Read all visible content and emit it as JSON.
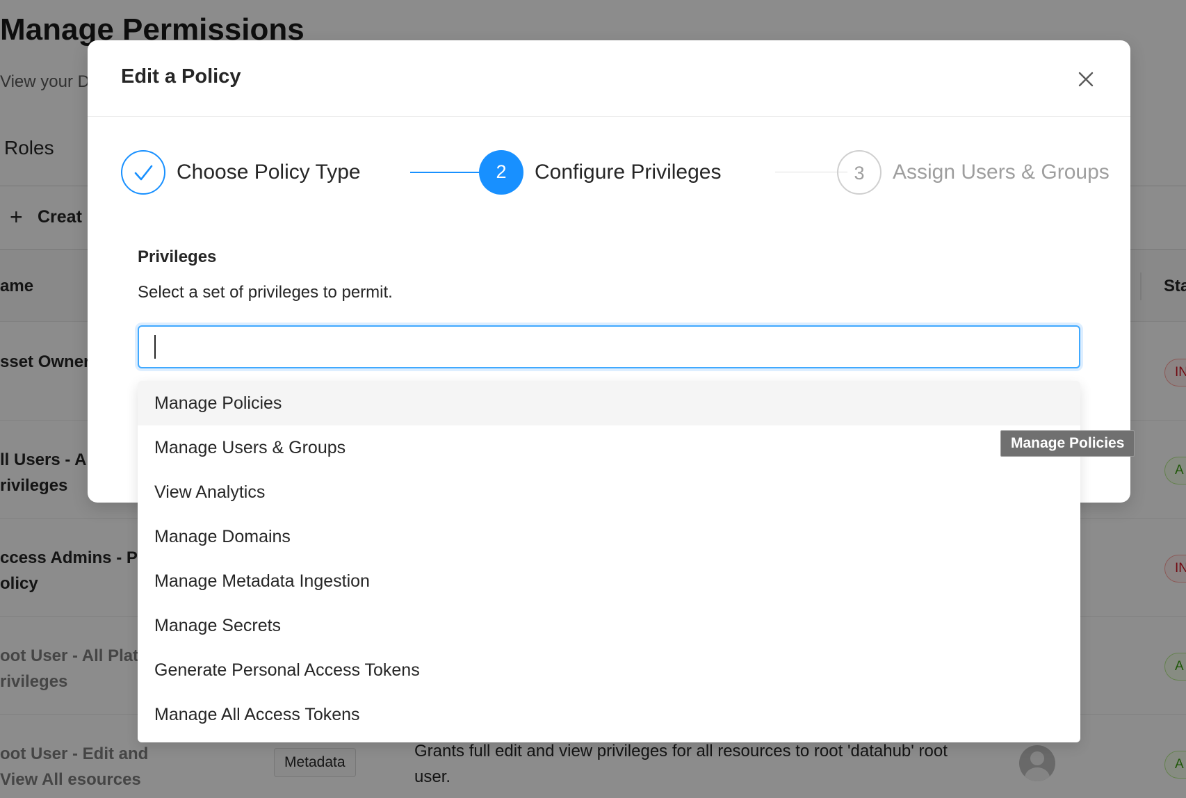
{
  "background": {
    "page_title": "Manage Permissions",
    "page_subtitle": "View your D",
    "tab_roles": "Roles",
    "create_button": "Creat",
    "create_plus": "+",
    "table": {
      "col_name": "ame",
      "col_status": "Sta",
      "rows": [
        {
          "name": "sset Owner policy",
          "status": "IN",
          "status_kind": "inactive",
          "muted": false
        },
        {
          "name": "ll Users - All rivileges",
          "status": "A",
          "status_kind": "active",
          "muted": false
        },
        {
          "name": "ccess Admins - Pla olicy",
          "status": "IN",
          "status_kind": "inactive",
          "muted": false
        },
        {
          "name": "oot User - All Platf rivileges",
          "status": "A",
          "status_kind": "active",
          "muted": true
        },
        {
          "name": "oot User - Edit and View All esources",
          "status": "A",
          "status_kind": "active",
          "muted": true,
          "tag": "Metadata",
          "description": "Grants full edit and view privileges for all resources to root 'datahub' root user."
        }
      ]
    }
  },
  "modal": {
    "title": "Edit a Policy",
    "close_icon": "close-icon",
    "steps": [
      {
        "number": "",
        "label": "Choose Policy Type",
        "state": "done",
        "icon": "check-icon"
      },
      {
        "number": "2",
        "label": "Configure Privileges",
        "state": "current"
      },
      {
        "number": "3",
        "label": "Assign Users & Groups",
        "state": "pending"
      }
    ],
    "privileges": {
      "label": "Privileges",
      "help": "Select a set of privileges to permit.",
      "input_value": "",
      "options": [
        "Manage Policies",
        "Manage Users & Groups",
        "View Analytics",
        "Manage Domains",
        "Manage Metadata Ingestion",
        "Manage Secrets",
        "Generate Personal Access Tokens",
        "Manage All Access Tokens"
      ],
      "highlighted_option": "Manage Policies",
      "tooltip": "Manage Policies"
    }
  },
  "colors": {
    "accent": "#1890ff",
    "overlay": "#8c8c8c",
    "inactive_badge": "#cf1322",
    "active_badge": "#389e0d"
  }
}
